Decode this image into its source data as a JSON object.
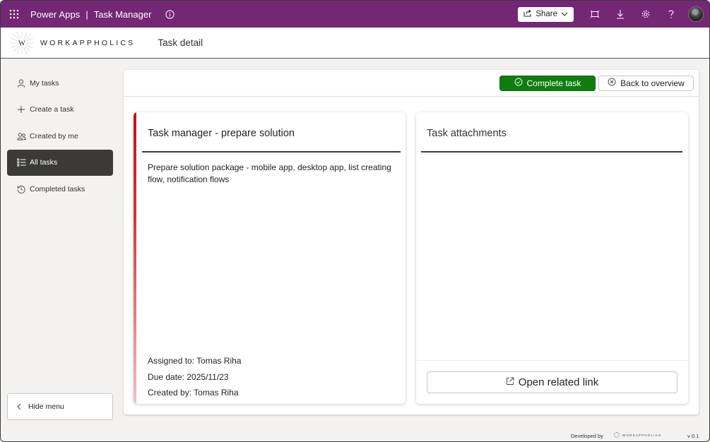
{
  "topbar": {
    "brand": "Power Apps",
    "separator": "|",
    "app_name": "Task Manager",
    "share_label": "Share",
    "icons": [
      "app-launcher-icon",
      "info-icon",
      "share-icon",
      "chevron-down-icon",
      "fit-to-window-icon",
      "download-icon",
      "settings-icon",
      "help-icon",
      "avatar"
    ],
    "background_color": "#742774"
  },
  "header": {
    "logo_letter": "W",
    "logo_text": "WORKAPPHOLICS",
    "page_title": "Task detail"
  },
  "sidebar": {
    "items": [
      {
        "label": "My tasks",
        "icon": "person-icon",
        "active": false
      },
      {
        "label": "Create a task",
        "icon": "plus-icon",
        "active": false
      },
      {
        "label": "Created by me",
        "icon": "people-icon",
        "active": false
      },
      {
        "label": "All tasks",
        "icon": "list-icon",
        "active": true
      },
      {
        "label": "Completed tasks",
        "icon": "history-icon",
        "active": false
      }
    ],
    "hide_menu_label": "Hide menu"
  },
  "actions": {
    "complete_label": "Complete task",
    "back_label": "Back to overview",
    "complete_color": "#107c10"
  },
  "task": {
    "title": "Task manager - prepare solution",
    "description": "Prepare solution package - mobile app, desktop app, list creating flow, notification flows",
    "assigned": "Assigned to: Tomas Riha",
    "due": "Due date: 2025/11/23",
    "created": "Created by: Tomas Riha",
    "accent_color": "#c50f1f"
  },
  "attachments": {
    "title": "Task attachments",
    "open_link_label": "Open related link"
  },
  "footer": {
    "developed_by": "Developed by",
    "brand": "WORKAPPHOLICS",
    "version": "v 0.1"
  }
}
